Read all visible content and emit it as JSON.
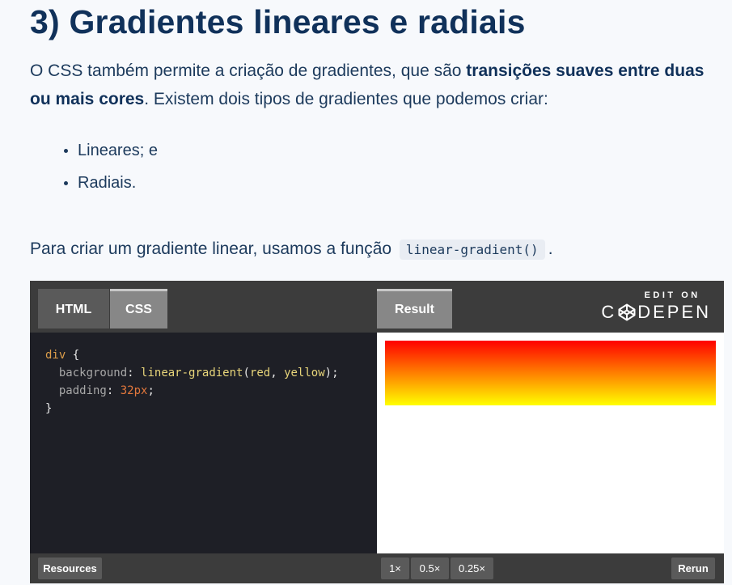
{
  "article": {
    "heading": "3) Gradientes lineares e radiais",
    "intro_before": "O CSS também permite a criação de gradientes, que são ",
    "intro_bold": "transições suaves entre duas ou mais cores",
    "intro_after": ". Existem dois tipos de gradientes que podemos criar:",
    "bullets": [
      "Lineares; e",
      "Radiais."
    ],
    "para2_before": "Para criar um gradiente linear, usamos a função",
    "para2_code": "linear-gradient()",
    "para2_after": "."
  },
  "embed": {
    "tabs": {
      "html": "HTML",
      "css": "CSS",
      "result": "Result"
    },
    "edit_on": "EDIT ON",
    "logo_left": "C",
    "logo_right": "DEPEN",
    "code": {
      "selector": "div",
      "open_brace": "{",
      "close_brace": "}",
      "prop1": "background",
      "fn": "linear-gradient",
      "arg1": "red",
      "arg2": "yellow",
      "prop2": "padding",
      "val2": "32px"
    },
    "result_gradient": {
      "from": "#ff0000",
      "to": "#ffff00"
    },
    "footer": {
      "resources": "Resources",
      "zoom": [
        "1×",
        "0.5×",
        "0.25×"
      ],
      "rerun": "Rerun"
    }
  }
}
